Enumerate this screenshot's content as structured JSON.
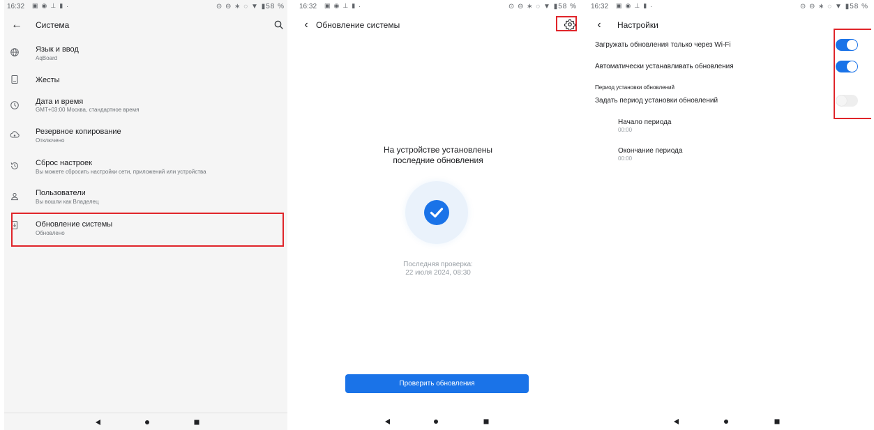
{
  "status_bar": {
    "time": "16:32",
    "left_icons": [
      "notification-icon",
      "cloud-icon",
      "upload-icon",
      "battery-saver-icon",
      "dot-icon"
    ],
    "right_text_s1": "⊙ ⊖ ∗ ◌ ▼ ▮58 %",
    "right_text_s2": "⊙ ⊖ ∗ ◌ ▼ ▮58 %",
    "right_text_s3": "⊙ ⊖ ∗ ◌ ▼ ▮58 %"
  },
  "system_screen": {
    "title": "Система",
    "items": [
      {
        "title": "Язык и ввод",
        "subtitle": "AqBoard",
        "icon": "globe-icon"
      },
      {
        "title": "Жесты",
        "subtitle": "",
        "icon": "phone-gesture-icon"
      },
      {
        "title": "Дата и время",
        "subtitle": "GMT+03:00 Москва, стандартное время",
        "icon": "clock-icon"
      },
      {
        "title": "Резервное копирование",
        "subtitle": "Отключено",
        "icon": "backup-icon"
      },
      {
        "title": "Сброс настроек",
        "subtitle": "Вы можете сбросить настройки сети, приложений или устройства",
        "icon": "history-icon"
      },
      {
        "title": "Пользователи",
        "subtitle": "Вы вошли как Владелец",
        "icon": "person-icon"
      },
      {
        "title": "Обновление системы",
        "subtitle": "Обновлено",
        "icon": "system-update-icon"
      }
    ]
  },
  "update_screen": {
    "title": "Обновление системы",
    "status_line1": "На устройстве установлены",
    "status_line2": "последние обновления",
    "last_check_label": "Последняя проверка:",
    "last_check_value": "22 июля 2024, 08:30",
    "check_button": "Проверить обновления"
  },
  "settings_screen": {
    "title": "Настройки",
    "wifi_only_label": "Загружать обновления только через Wi-Fi",
    "wifi_only_enabled": true,
    "auto_install_label": "Автоматически устанавливать обновления",
    "auto_install_enabled": true,
    "period_section": "Период установки обновлений",
    "set_period_label": "Задать период установки обновлений",
    "set_period_enabled": false,
    "period_start_label": "Начало периода",
    "period_start_value": "00:00",
    "period_end_label": "Окончание периода",
    "period_end_value": "00:00"
  },
  "colors": {
    "accent": "#1a73e8",
    "highlight": "#e0252a"
  }
}
